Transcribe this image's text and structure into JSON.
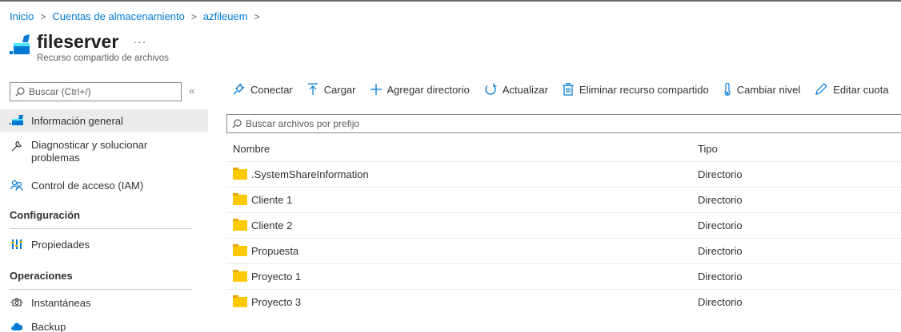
{
  "breadcrumb": {
    "items": [
      "Inicio",
      "Cuentas de almacenamiento",
      "azfileuem"
    ],
    "separator": ">"
  },
  "resource": {
    "title": "fileserver",
    "more": "···",
    "subtitle": "Recurso compartido de archivos"
  },
  "sidebar": {
    "search_placeholder": "Buscar (Ctrl+/)",
    "collapse": "«",
    "items": [
      {
        "label": "Información general",
        "icon": "file-share-icon"
      },
      {
        "label": "Diagnosticar y solucionar problemas",
        "icon": "wrench-icon"
      },
      {
        "label": "Control de acceso (IAM)",
        "icon": "people-icon"
      }
    ],
    "sections": [
      {
        "title": "Configuración",
        "items": [
          {
            "label": "Propiedades",
            "icon": "properties-icon"
          }
        ]
      },
      {
        "title": "Operaciones",
        "items": [
          {
            "label": "Instantáneas",
            "icon": "snapshot-icon"
          },
          {
            "label": "Backup",
            "icon": "backup-cloud-icon"
          }
        ]
      }
    ]
  },
  "toolbar": {
    "connect": "Conectar",
    "upload": "Cargar",
    "add_directory": "Agregar directorio",
    "refresh": "Actualizar",
    "delete_share": "Eliminar recurso compartido",
    "change_tier": "Cambiar nivel",
    "edit_quota": "Editar cuota"
  },
  "filter": {
    "placeholder": "Buscar archivos por prefijo"
  },
  "table": {
    "columns": [
      "Nombre",
      "Tipo"
    ],
    "rows": [
      {
        "name": ".SystemShareInformation",
        "type": "Directorio"
      },
      {
        "name": "Cliente 1",
        "type": "Directorio"
      },
      {
        "name": "Cliente 2",
        "type": "Directorio"
      },
      {
        "name": "Propuesta",
        "type": "Directorio"
      },
      {
        "name": "Proyecto 1",
        "type": "Directorio"
      },
      {
        "name": "Proyecto 3",
        "type": "Directorio"
      }
    ]
  },
  "colors": {
    "accent": "#0078d4",
    "folder": "#ffc900",
    "active_bg": "#edebe9"
  }
}
